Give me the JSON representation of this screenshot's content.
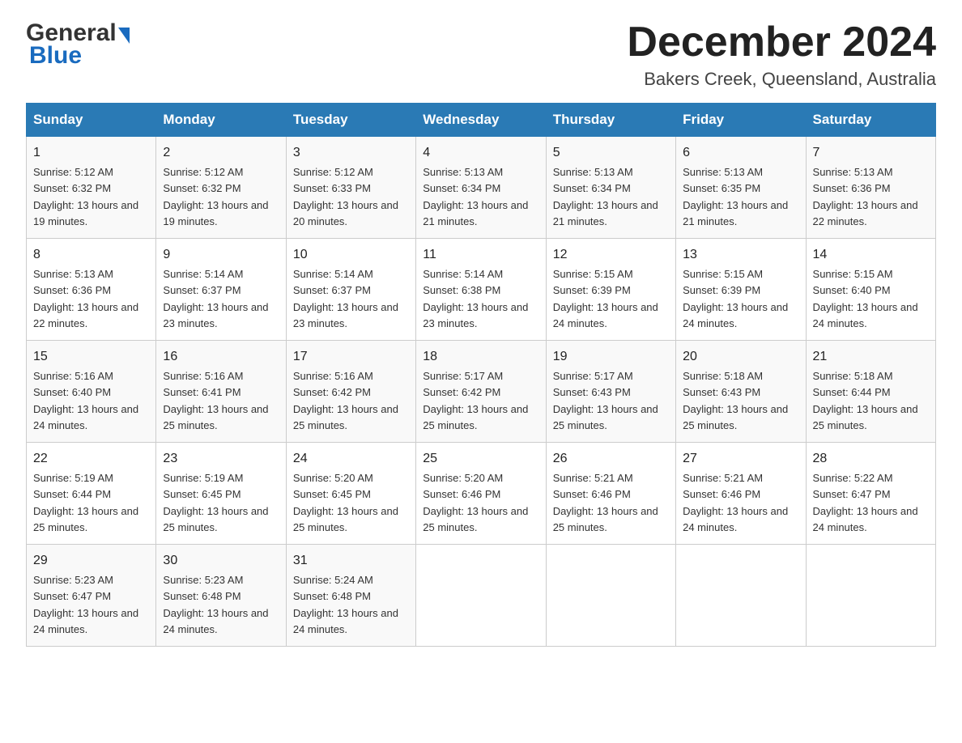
{
  "header": {
    "logo_general": "General",
    "logo_blue": "Blue",
    "month_title": "December 2024",
    "location": "Bakers Creek, Queensland, Australia"
  },
  "days_of_week": [
    "Sunday",
    "Monday",
    "Tuesday",
    "Wednesday",
    "Thursday",
    "Friday",
    "Saturday"
  ],
  "weeks": [
    [
      {
        "day": "1",
        "sunrise": "5:12 AM",
        "sunset": "6:32 PM",
        "daylight": "13 hours and 19 minutes."
      },
      {
        "day": "2",
        "sunrise": "5:12 AM",
        "sunset": "6:32 PM",
        "daylight": "13 hours and 19 minutes."
      },
      {
        "day": "3",
        "sunrise": "5:12 AM",
        "sunset": "6:33 PM",
        "daylight": "13 hours and 20 minutes."
      },
      {
        "day": "4",
        "sunrise": "5:13 AM",
        "sunset": "6:34 PM",
        "daylight": "13 hours and 21 minutes."
      },
      {
        "day": "5",
        "sunrise": "5:13 AM",
        "sunset": "6:34 PM",
        "daylight": "13 hours and 21 minutes."
      },
      {
        "day": "6",
        "sunrise": "5:13 AM",
        "sunset": "6:35 PM",
        "daylight": "13 hours and 21 minutes."
      },
      {
        "day": "7",
        "sunrise": "5:13 AM",
        "sunset": "6:36 PM",
        "daylight": "13 hours and 22 minutes."
      }
    ],
    [
      {
        "day": "8",
        "sunrise": "5:13 AM",
        "sunset": "6:36 PM",
        "daylight": "13 hours and 22 minutes."
      },
      {
        "day": "9",
        "sunrise": "5:14 AM",
        "sunset": "6:37 PM",
        "daylight": "13 hours and 23 minutes."
      },
      {
        "day": "10",
        "sunrise": "5:14 AM",
        "sunset": "6:37 PM",
        "daylight": "13 hours and 23 minutes."
      },
      {
        "day": "11",
        "sunrise": "5:14 AM",
        "sunset": "6:38 PM",
        "daylight": "13 hours and 23 minutes."
      },
      {
        "day": "12",
        "sunrise": "5:15 AM",
        "sunset": "6:39 PM",
        "daylight": "13 hours and 24 minutes."
      },
      {
        "day": "13",
        "sunrise": "5:15 AM",
        "sunset": "6:39 PM",
        "daylight": "13 hours and 24 minutes."
      },
      {
        "day": "14",
        "sunrise": "5:15 AM",
        "sunset": "6:40 PM",
        "daylight": "13 hours and 24 minutes."
      }
    ],
    [
      {
        "day": "15",
        "sunrise": "5:16 AM",
        "sunset": "6:40 PM",
        "daylight": "13 hours and 24 minutes."
      },
      {
        "day": "16",
        "sunrise": "5:16 AM",
        "sunset": "6:41 PM",
        "daylight": "13 hours and 25 minutes."
      },
      {
        "day": "17",
        "sunrise": "5:16 AM",
        "sunset": "6:42 PM",
        "daylight": "13 hours and 25 minutes."
      },
      {
        "day": "18",
        "sunrise": "5:17 AM",
        "sunset": "6:42 PM",
        "daylight": "13 hours and 25 minutes."
      },
      {
        "day": "19",
        "sunrise": "5:17 AM",
        "sunset": "6:43 PM",
        "daylight": "13 hours and 25 minutes."
      },
      {
        "day": "20",
        "sunrise": "5:18 AM",
        "sunset": "6:43 PM",
        "daylight": "13 hours and 25 minutes."
      },
      {
        "day": "21",
        "sunrise": "5:18 AM",
        "sunset": "6:44 PM",
        "daylight": "13 hours and 25 minutes."
      }
    ],
    [
      {
        "day": "22",
        "sunrise": "5:19 AM",
        "sunset": "6:44 PM",
        "daylight": "13 hours and 25 minutes."
      },
      {
        "day": "23",
        "sunrise": "5:19 AM",
        "sunset": "6:45 PM",
        "daylight": "13 hours and 25 minutes."
      },
      {
        "day": "24",
        "sunrise": "5:20 AM",
        "sunset": "6:45 PM",
        "daylight": "13 hours and 25 minutes."
      },
      {
        "day": "25",
        "sunrise": "5:20 AM",
        "sunset": "6:46 PM",
        "daylight": "13 hours and 25 minutes."
      },
      {
        "day": "26",
        "sunrise": "5:21 AM",
        "sunset": "6:46 PM",
        "daylight": "13 hours and 25 minutes."
      },
      {
        "day": "27",
        "sunrise": "5:21 AM",
        "sunset": "6:46 PM",
        "daylight": "13 hours and 24 minutes."
      },
      {
        "day": "28",
        "sunrise": "5:22 AM",
        "sunset": "6:47 PM",
        "daylight": "13 hours and 24 minutes."
      }
    ],
    [
      {
        "day": "29",
        "sunrise": "5:23 AM",
        "sunset": "6:47 PM",
        "daylight": "13 hours and 24 minutes."
      },
      {
        "day": "30",
        "sunrise": "5:23 AM",
        "sunset": "6:48 PM",
        "daylight": "13 hours and 24 minutes."
      },
      {
        "day": "31",
        "sunrise": "5:24 AM",
        "sunset": "6:48 PM",
        "daylight": "13 hours and 24 minutes."
      },
      null,
      null,
      null,
      null
    ]
  ]
}
